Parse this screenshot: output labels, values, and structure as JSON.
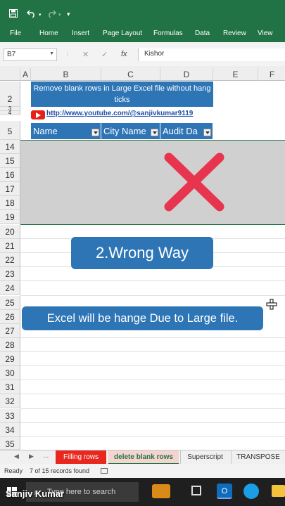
{
  "ribbon": {
    "tabs": [
      "File",
      "Home",
      "Insert",
      "Page Layout",
      "Formulas",
      "Data",
      "Review",
      "View"
    ]
  },
  "formula_bar": {
    "name_box": "B7",
    "cancel_symbol": "✕",
    "enter_symbol": "✓",
    "fx_symbol": "fx",
    "content": "Kishor"
  },
  "columns": [
    "A",
    "B",
    "C",
    "D",
    "E",
    "F"
  ],
  "rows": [
    "2",
    "3",
    "4",
    "5",
    "14",
    "15",
    "16",
    "17",
    "18",
    "19",
    "20",
    "21",
    "22",
    "23",
    "24",
    "25",
    "26",
    "27",
    "28",
    "29",
    "30",
    "31",
    "32",
    "33",
    "34",
    "35"
  ],
  "sheet": {
    "title": "Remove blank rows in Large Excel file without hang ticks",
    "link": "http://www.youtube.com/@sanjivkumar9119",
    "headers": [
      "Name",
      "City Name",
      "Audit Da"
    ],
    "wrong_way": "2.Wrong Way",
    "message": "Excel will be hange Due to Large file."
  },
  "tabs": {
    "ellipsis": "...",
    "items": [
      "Filling rows",
      "delete blank rows",
      "Superscript",
      "TRANSPOSE"
    ]
  },
  "status": {
    "ready": "Ready",
    "records": "7 of 15 records found"
  },
  "taskbar": {
    "search_placeholder": "Type here to search"
  },
  "watermark": "Sanjiv Kumar",
  "colors": {
    "excel_green": "#217346",
    "header_blue": "#2e75b6",
    "cross_red": "#e8354f",
    "tab_red": "#e8271f"
  }
}
